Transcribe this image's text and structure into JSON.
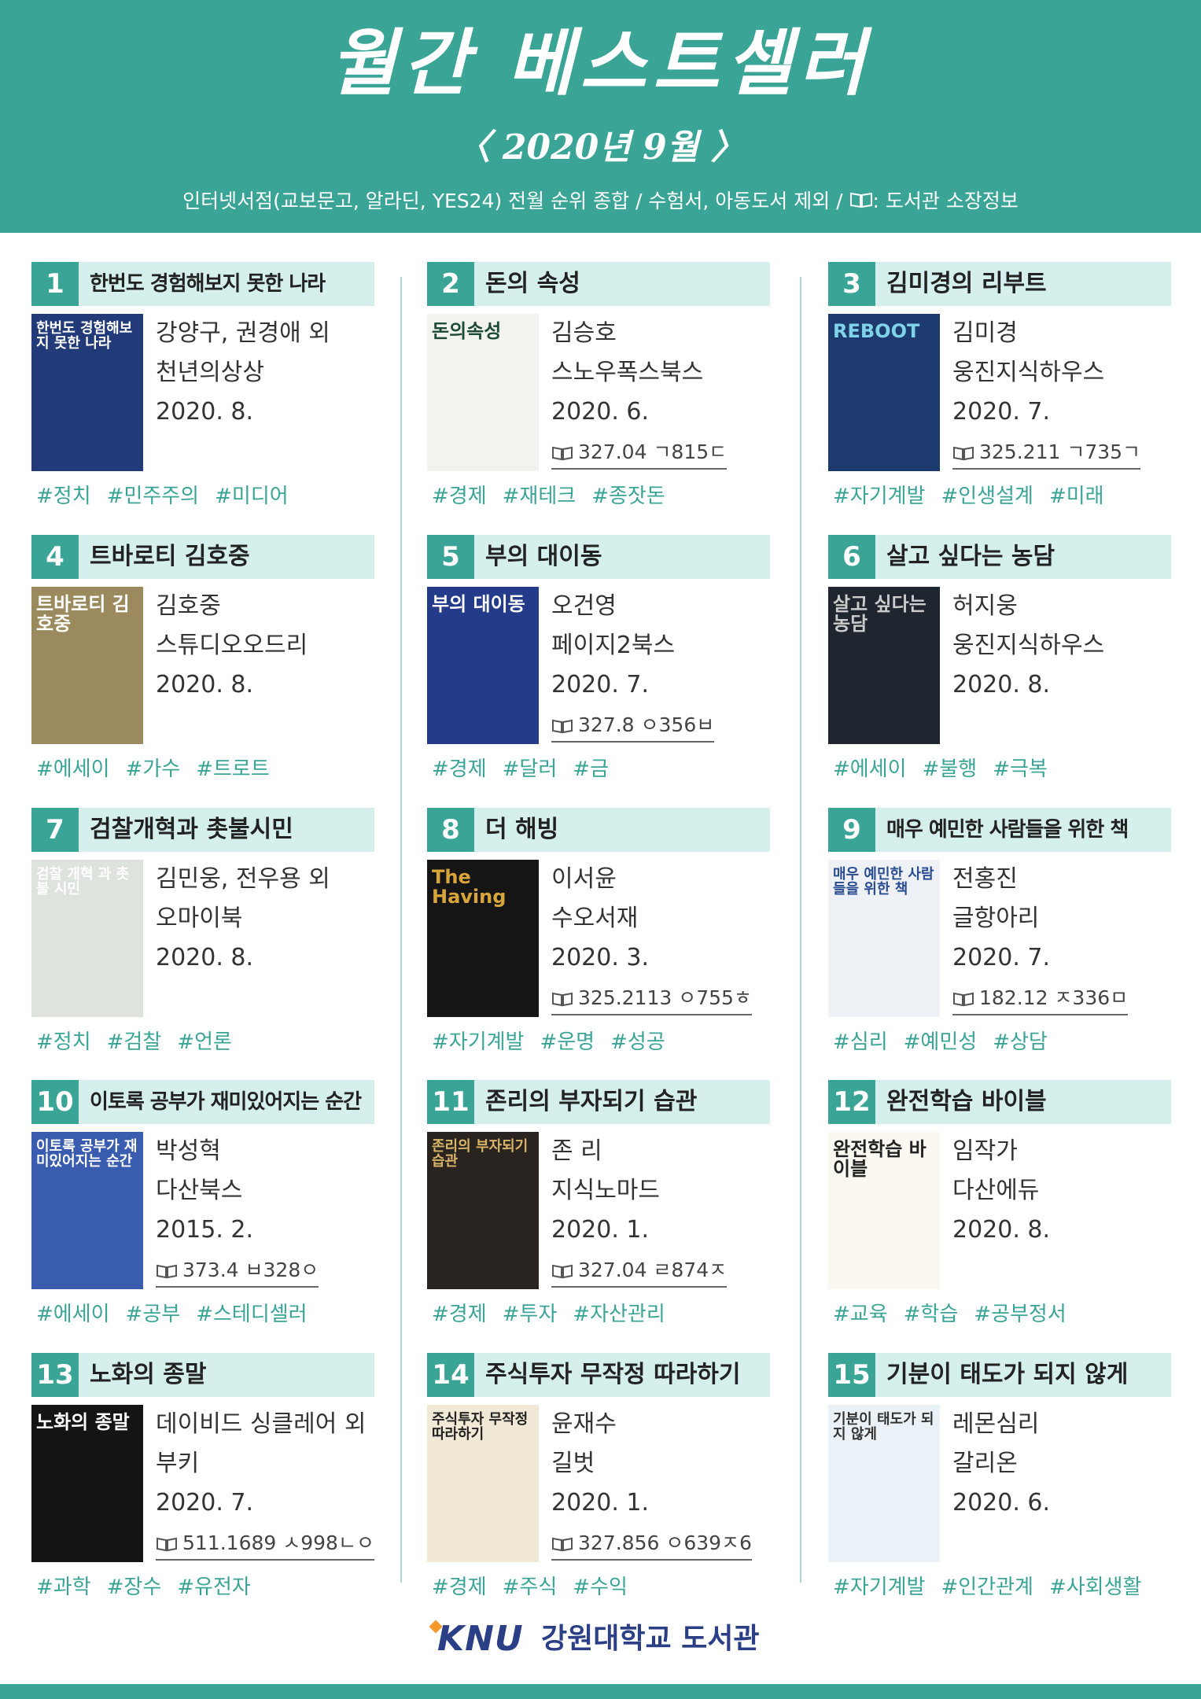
{
  "header": {
    "title": "월간 베스트셀러",
    "subtitle": "〈 2020년 9월 〉",
    "note_prefix": "인터넷서점(교보문고, 알라딘, YES24) 전월 순위 종합 / 수험서, 아동도서 제외 / ",
    "note_suffix": ": 도서관 소장정보"
  },
  "colors": {
    "accent": "#3aa596",
    "head_bg": "#d4efec",
    "logo": "#2a3f86"
  },
  "books": [
    {
      "rank": "1",
      "title": "한번도 경험해보지 못한 나라",
      "author": "강양구, 권경애 외",
      "publisher": "천년의상상",
      "date": "2020. 8.",
      "call_no": "",
      "tags": [
        "#정치",
        "#민주주의",
        "#미디어"
      ],
      "cover_text": "한번도 경험해보지 못한 나라",
      "cover_bg": "#223a78",
      "cover_fg": "#ffffff"
    },
    {
      "rank": "2",
      "title": "돈의 속성",
      "author": "김승호",
      "publisher": "스노우폭스북스",
      "date": "2020. 6.",
      "call_no": "327.04 ㄱ815ㄷ",
      "tags": [
        "#경제",
        "#재테크",
        "#종잣돈"
      ],
      "cover_text": "돈의속성",
      "cover_bg": "#f2f2ee",
      "cover_fg": "#1c4a36"
    },
    {
      "rank": "3",
      "title": "김미경의 리부트",
      "author": "김미경",
      "publisher": "웅진지식하우스",
      "date": "2020. 7.",
      "call_no": "325.211 ㄱ735ㄱ",
      "tags": [
        "#자기계발",
        "#인생설계",
        "#미래"
      ],
      "cover_text": "REBOOT",
      "cover_bg": "#1d3a6e",
      "cover_fg": "#7fd2e8"
    },
    {
      "rank": "4",
      "title": "트바로티 김호중",
      "author": "김호중",
      "publisher": "스튜디오오드리",
      "date": "2020. 8.",
      "call_no": "",
      "tags": [
        "#에세이",
        "#가수",
        "#트로트"
      ],
      "cover_text": "트바로티 김호중",
      "cover_bg": "#9a8a5e",
      "cover_fg": "#ffffff"
    },
    {
      "rank": "5",
      "title": "부의 대이동",
      "author": "오건영",
      "publisher": "페이지2북스",
      "date": "2020. 7.",
      "call_no": "327.8 ㅇ356ㅂ",
      "tags": [
        "#경제",
        "#달러",
        "#금"
      ],
      "cover_text": "부의 대이동",
      "cover_bg": "#243b8a",
      "cover_fg": "#ffffff"
    },
    {
      "rank": "6",
      "title": "살고 싶다는 농담",
      "author": "허지웅",
      "publisher": "웅진지식하우스",
      "date": "2020. 8.",
      "call_no": "",
      "tags": [
        "#에세이",
        "#불행",
        "#극복"
      ],
      "cover_text": "살고 싶다는 농담",
      "cover_bg": "#1f2630",
      "cover_fg": "#cccccc"
    },
    {
      "rank": "7",
      "title": "검찰개혁과 촛불시민",
      "author": "김민웅, 전우용 외",
      "publisher": "오마이북",
      "date": "2020. 8.",
      "call_no": "",
      "tags": [
        "#정치",
        "#검찰",
        "#언론"
      ],
      "cover_text": "검찰 개혁 과 촛불 시민",
      "cover_bg": "#dfe3de",
      "cover_fg": "#ffffff"
    },
    {
      "rank": "8",
      "title": "더 해빙",
      "author": "이서윤",
      "publisher": "수오서재",
      "date": "2020. 3.",
      "call_no": "325.2113 ㅇ755ㅎ",
      "tags": [
        "#자기계발",
        "#운명",
        "#성공"
      ],
      "cover_text": "The Having",
      "cover_bg": "#151515",
      "cover_fg": "#d8a53a"
    },
    {
      "rank": "9",
      "title": "매우 예민한 사람들을 위한 책",
      "author": "전홍진",
      "publisher": "글항아리",
      "date": "2020. 7.",
      "call_no": "182.12 ㅈ336ㅁ",
      "tags": [
        "#심리",
        "#예민성",
        "#상담"
      ],
      "cover_text": "매우 예민한 사람들을 위한 책",
      "cover_bg": "#eef2f7",
      "cover_fg": "#2a4d8f"
    },
    {
      "rank": "10",
      "title": "이토록 공부가 재미있어지는 순간",
      "author": "박성혁",
      "publisher": "다산북스",
      "date": "2015. 2.",
      "call_no": "373.4 ㅂ328ㅇ",
      "tags": [
        "#에세이",
        "#공부",
        "#스테디셀러"
      ],
      "cover_text": "이토록 공부가 재미있어지는 순간",
      "cover_bg": "#3a5cae",
      "cover_fg": "#ffffff"
    },
    {
      "rank": "11",
      "title": "존리의 부자되기 습관",
      "author": "존 리",
      "publisher": "지식노마드",
      "date": "2020. 1.",
      "call_no": "327.04 ㄹ874ㅈ",
      "tags": [
        "#경제",
        "#투자",
        "#자산관리"
      ],
      "cover_text": "존리의 부자되기 습관",
      "cover_bg": "#2a2420",
      "cover_fg": "#d9b56a"
    },
    {
      "rank": "12",
      "title": "완전학습 바이블",
      "author": "임작가",
      "publisher": "다산에듀",
      "date": "2020. 8.",
      "call_no": "",
      "tags": [
        "#교육",
        "#학습",
        "#공부정서"
      ],
      "cover_text": "완전학습 바이블",
      "cover_bg": "#faf8f0",
      "cover_fg": "#222222"
    },
    {
      "rank": "13",
      "title": "노화의 종말",
      "author": "데이비드 싱클레어 외",
      "publisher": "부키",
      "date": "2020. 7.",
      "call_no": "511.1689 ㅅ998ㄴㅇ",
      "tags": [
        "#과학",
        "#장수",
        "#유전자"
      ],
      "cover_text": "노화의 종말",
      "cover_bg": "#141414",
      "cover_fg": "#ffffff"
    },
    {
      "rank": "14",
      "title": "주식투자 무작정 따라하기",
      "author": "윤재수",
      "publisher": "길벗",
      "date": "2020. 1.",
      "call_no": "327.856 ㅇ639ㅈ6",
      "tags": [
        "#경제",
        "#주식",
        "#수익"
      ],
      "cover_text": "주식투자 무작정 따라하기",
      "cover_bg": "#f1e9d6",
      "cover_fg": "#222222"
    },
    {
      "rank": "15",
      "title": "기분이 태도가 되지 않게",
      "author": "레몬심리",
      "publisher": "갈리온",
      "date": "2020. 6.",
      "call_no": "",
      "tags": [
        "#자기계발",
        "#인간관계",
        "#사회생활"
      ],
      "cover_text": "기분이 태도가 되지 않게",
      "cover_bg": "#eaf2f7",
      "cover_fg": "#333333"
    }
  ],
  "footer": {
    "logo_text": "KNU",
    "library_name": "강원대학교 도서관"
  }
}
